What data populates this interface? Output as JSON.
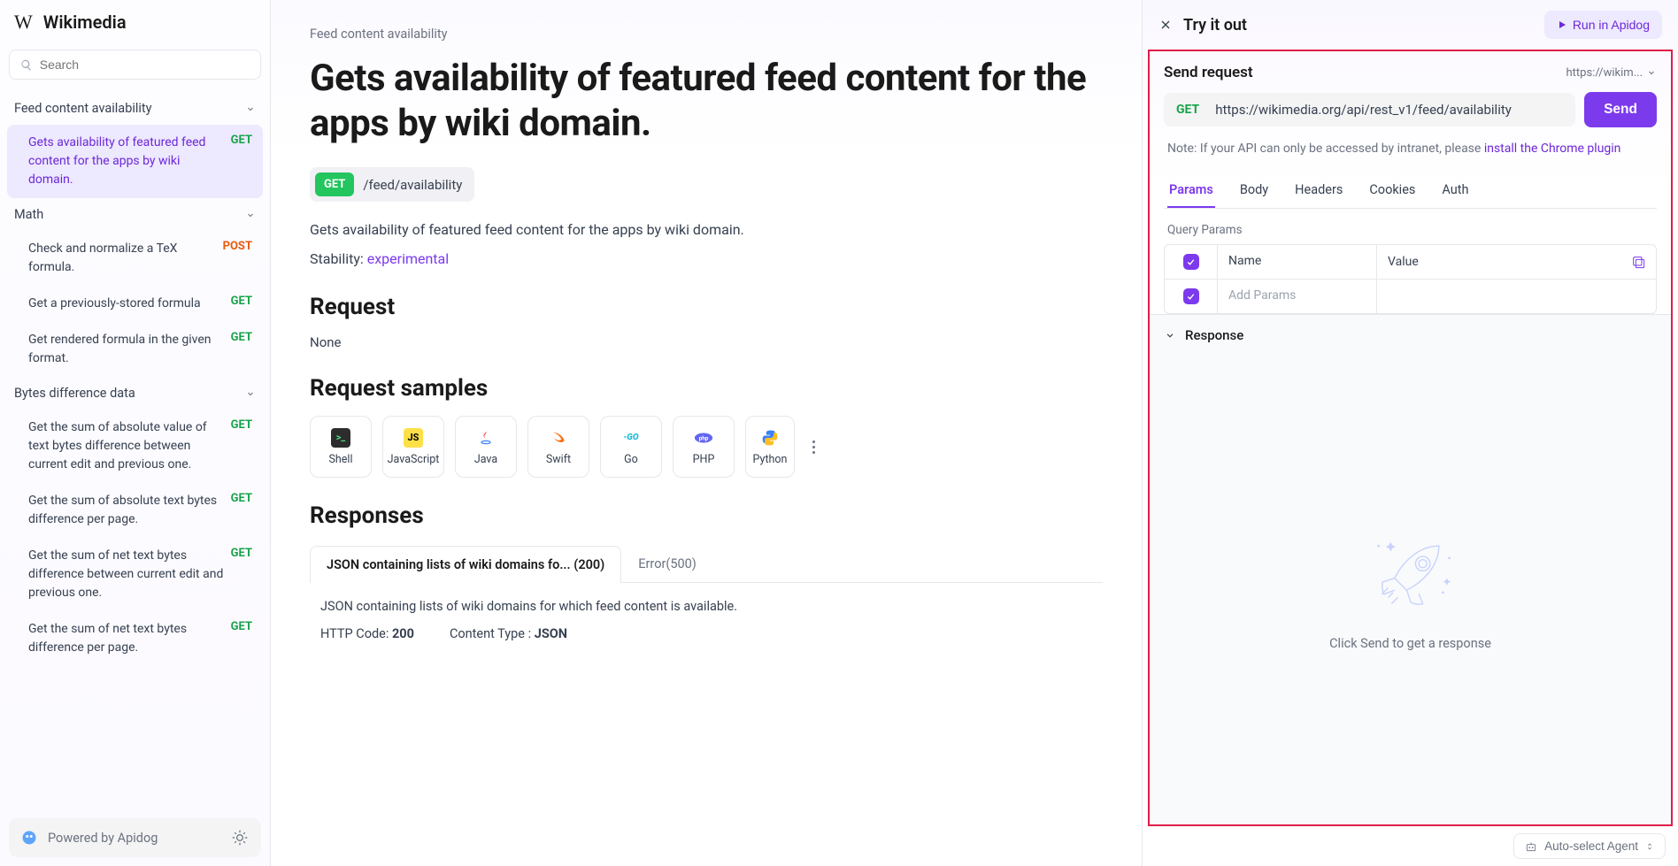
{
  "brand": {
    "name": "Wikimedia",
    "logo_glyph": "W"
  },
  "search": {
    "placeholder": "Search"
  },
  "sidebar": {
    "sections": [
      {
        "title": "Feed content availability",
        "items": [
          {
            "label": "Gets availability of featured feed content for the apps by wiki domain.",
            "method": "GET",
            "active": true
          }
        ]
      },
      {
        "title": "Math",
        "items": [
          {
            "label": "Check and normalize a TeX formula.",
            "method": "POST"
          },
          {
            "label": "Get a previously-stored formula",
            "method": "GET"
          },
          {
            "label": "Get rendered formula in the given format.",
            "method": "GET"
          }
        ]
      },
      {
        "title": "Bytes difference data",
        "items": [
          {
            "label": "Get the sum of absolute value of text bytes difference between current edit and previous one.",
            "method": "GET"
          },
          {
            "label": "Get the sum of absolute text bytes difference per page.",
            "method": "GET"
          },
          {
            "label": "Get the sum of net text bytes difference between current edit and previous one.",
            "method": "GET"
          },
          {
            "label": "Get the sum of net text bytes difference per page.",
            "method": "GET"
          }
        ]
      }
    ],
    "footer": {
      "powered": "Powered by Apidog"
    }
  },
  "main": {
    "breadcrumb": "Feed content availability",
    "title": "Gets availability of featured feed content for the apps by wiki domain.",
    "endpoint": {
      "method": "GET",
      "path": "/feed/availability"
    },
    "description": "Gets availability of featured feed content for the apps by wiki domain.",
    "stability_label": "Stability: ",
    "stability_value": "experimental",
    "request_h": "Request",
    "request_none": "None",
    "samples_h": "Request samples",
    "samples": [
      "Shell",
      "JavaScript",
      "Java",
      "Swift",
      "Go",
      "PHP",
      "Python"
    ],
    "responses_h": "Responses",
    "response_tabs": [
      {
        "label": "JSON containing lists of wiki domains fo... (200)",
        "active": true
      },
      {
        "label": "Error(500)"
      }
    ],
    "response_desc": "JSON containing lists of wiki domains for which feed content is available.",
    "http_code_label": "HTTP Code: ",
    "http_code": "200",
    "content_type_label": "Content Type : ",
    "content_type": "JSON"
  },
  "right": {
    "tryit": "Try it out",
    "run_label": "Run in Apidog",
    "send_title": "Send request",
    "url_short": "https://wikim...",
    "method": "GET",
    "url": "https://wikimedia.org/api/rest_v1/feed/availability",
    "send_btn": "Send",
    "note_prefix": "Note: If your API can only be accessed by intranet, please ",
    "note_link": "install the Chrome plugin",
    "tabs": [
      "Params",
      "Body",
      "Headers",
      "Cookies",
      "Auth"
    ],
    "query_label": "Query Params",
    "param_header_name": "Name",
    "param_header_value": "Value",
    "add_placeholder": "Add Params",
    "response_label": "Response",
    "response_empty": "Click Send to get a response",
    "agent": "Auto-select Agent"
  }
}
